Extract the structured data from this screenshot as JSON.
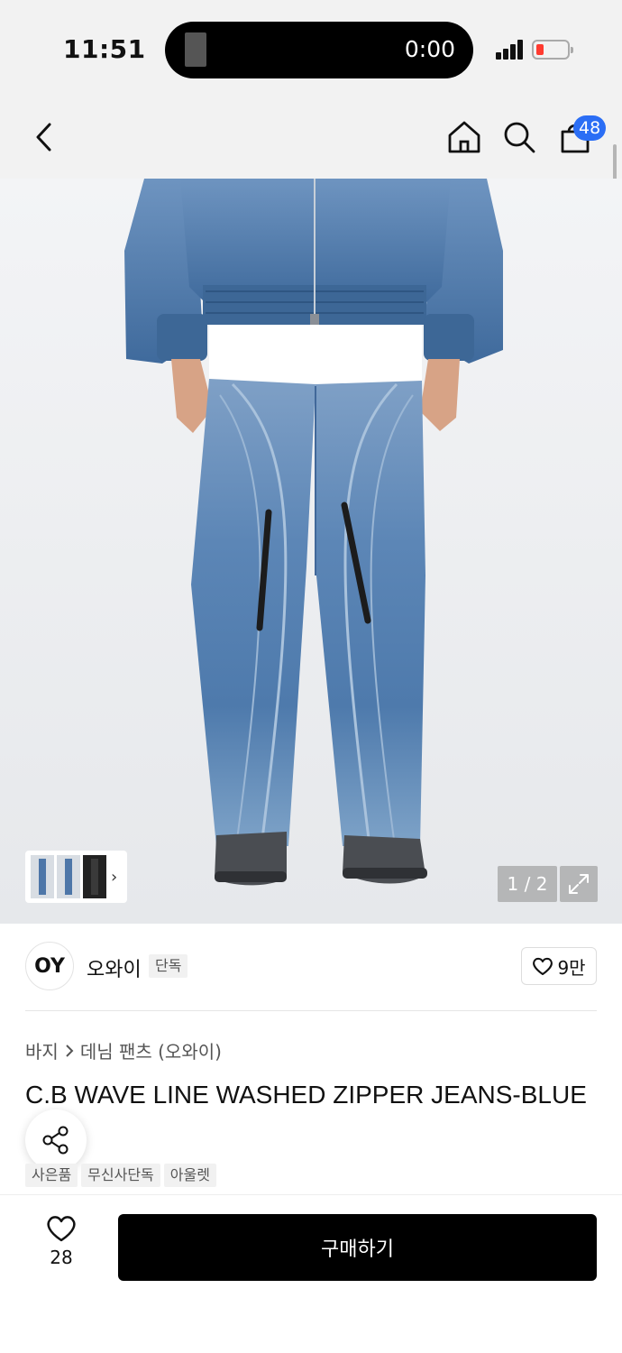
{
  "status_bar": {
    "time": "11:51",
    "media_time": "0:00"
  },
  "nav": {
    "cart_count": "48"
  },
  "gallery": {
    "page_indicator": "1 / 2"
  },
  "brand": {
    "logo_text": "OY",
    "name": "오와이",
    "badge": "단독",
    "likes": "9만"
  },
  "breadcrumb": {
    "category": "바지",
    "subcategory": "데님 팬츠 (오와이)"
  },
  "product": {
    "title": "C.B WAVE LINE WASHED ZIPPER JEANS-BLUE",
    "tags": [
      "사은품",
      "무신사단독",
      "아울렛"
    ]
  },
  "bottom": {
    "wish_count": "28",
    "buy_label": "구매하기"
  },
  "colors": {
    "accent": "#2b6ef5",
    "denim": "#5a86b6",
    "denim_dark": "#3e6897",
    "buy_button": "#000000"
  }
}
